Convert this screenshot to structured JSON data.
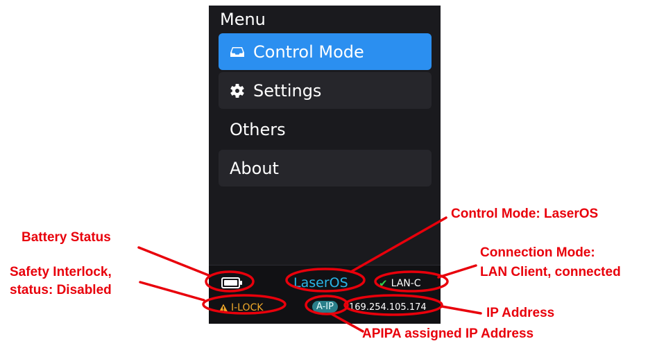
{
  "menu": {
    "title": "Menu",
    "items": [
      {
        "label": "Control Mode",
        "icon": "inbox-tray-icon",
        "selected": true
      },
      {
        "label": "Settings",
        "icon": "gear-icon",
        "selected": false
      },
      {
        "label": "Others",
        "icon": "",
        "selected": false
      },
      {
        "label": "About",
        "icon": "",
        "selected": false
      }
    ]
  },
  "status": {
    "battery_icon": "battery-icon",
    "control_mode": "LaserOS",
    "connection": "LAN-C",
    "connection_icon": "checkmark-icon",
    "interlock": "I-LOCK",
    "interlock_icon": "warning-icon",
    "ip_badge": "A-IP",
    "ip_address": "169.254.105.174"
  },
  "annotations": {
    "battery": "Battery Status",
    "interlock_line1": "Safety Interlock,",
    "interlock_line2": "status: Disabled",
    "control_mode": "Control Mode: LaserOS",
    "connection_line1": "Connection Mode:",
    "connection_line2": "LAN Client, connected",
    "ip": "IP Address",
    "apipa": "APIPA assigned IP Address"
  },
  "colors": {
    "selected": "#2b8ff0",
    "item_bg": "#26262b",
    "screen_bg": "#1a1a1e",
    "laseros": "#2ab6e8",
    "warning": "#f1a92a",
    "ok": "#2fd14a",
    "badge": "#2a7f8a",
    "annotation": "#e8000b"
  }
}
